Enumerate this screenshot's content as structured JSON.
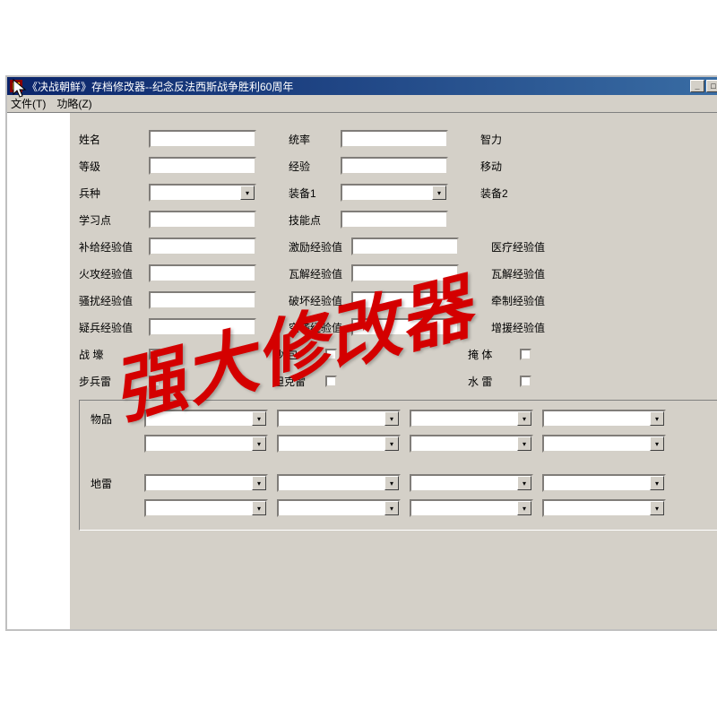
{
  "window": {
    "title": "《决战朝鲜》存档修改器--纪念反法西斯战争胜利60周年"
  },
  "menus": {
    "file": "文件(T)",
    "func": "功略(Z)"
  },
  "labels": {
    "name": "姓名",
    "leadership": "统率",
    "intelligence": "智力",
    "level": "等级",
    "experience": "经验",
    "movement": "移动",
    "unit_type": "兵种",
    "equip1": "装备1",
    "equip2": "装备2",
    "study_points": "学习点",
    "skill_points": "技能点",
    "supply_exp": "补给经验值",
    "morale_exp": "激励经验值",
    "medical_exp": "医疗经验值",
    "fire_exp": "火攻经验值",
    "collapse_exp": "瓦解经验值",
    "harass_exp": "骚扰经验值",
    "destroy_exp": "破坏经验值",
    "restrain_exp": "牵制经验值",
    "ambush_exp": "疑兵经验值",
    "airdrop_exp": "空袭经验值",
    "reinforce_exp": "增援经验值",
    "trench": "战 壕",
    "sandbag": "沙 包",
    "bunker": "掩 体",
    "inf_mine": "步兵雷",
    "tank_mine": "坦克雷",
    "naval_mine": "水 雷",
    "items": "物品",
    "landmine": "地雷"
  },
  "watermark": "强大修改器"
}
